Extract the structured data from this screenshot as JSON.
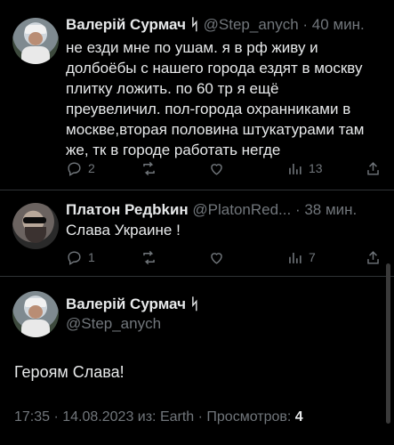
{
  "tweet1": {
    "name": "Валерій Сурмач",
    "badge": "ᛋ",
    "handle": "@Step_anych",
    "time": "· 40 мин.",
    "lines": [
      "не езди мне по ушам. я в рф живу и",
      "долбоёбы с нашего города  ездят в москву",
      "плитку ложить. по 60 тр я ещё",
      "преувеличил. пол-города охранниками в",
      "москве,вторая половина штукатурами там",
      "же, тк в городе работать негде"
    ],
    "replies": "2",
    "retweets": "",
    "likes": "",
    "views": "13"
  },
  "tweet2": {
    "name": "Платон Редbkин",
    "handle": "@PlatonRed...",
    "time": "· 38 мин.",
    "text": "Слава Украине !",
    "replies": "1",
    "views": "7"
  },
  "focused": {
    "name": "Валерій Сурмач",
    "badge": "ᛋ",
    "handle": "@Step_anych",
    "text": "Героям Слава!",
    "meta_prefix": "17:35 · 14.08.2023 из: Earth · Просмотров: ",
    "meta_views": "4"
  },
  "icons": [
    "reply-icon",
    "retweet-icon",
    "like-icon",
    "views-icon",
    "share-icon"
  ],
  "colors": {
    "background": "#000000",
    "text": "#e7e9ea",
    "muted": "#71767b",
    "divider": "#2f3336"
  }
}
